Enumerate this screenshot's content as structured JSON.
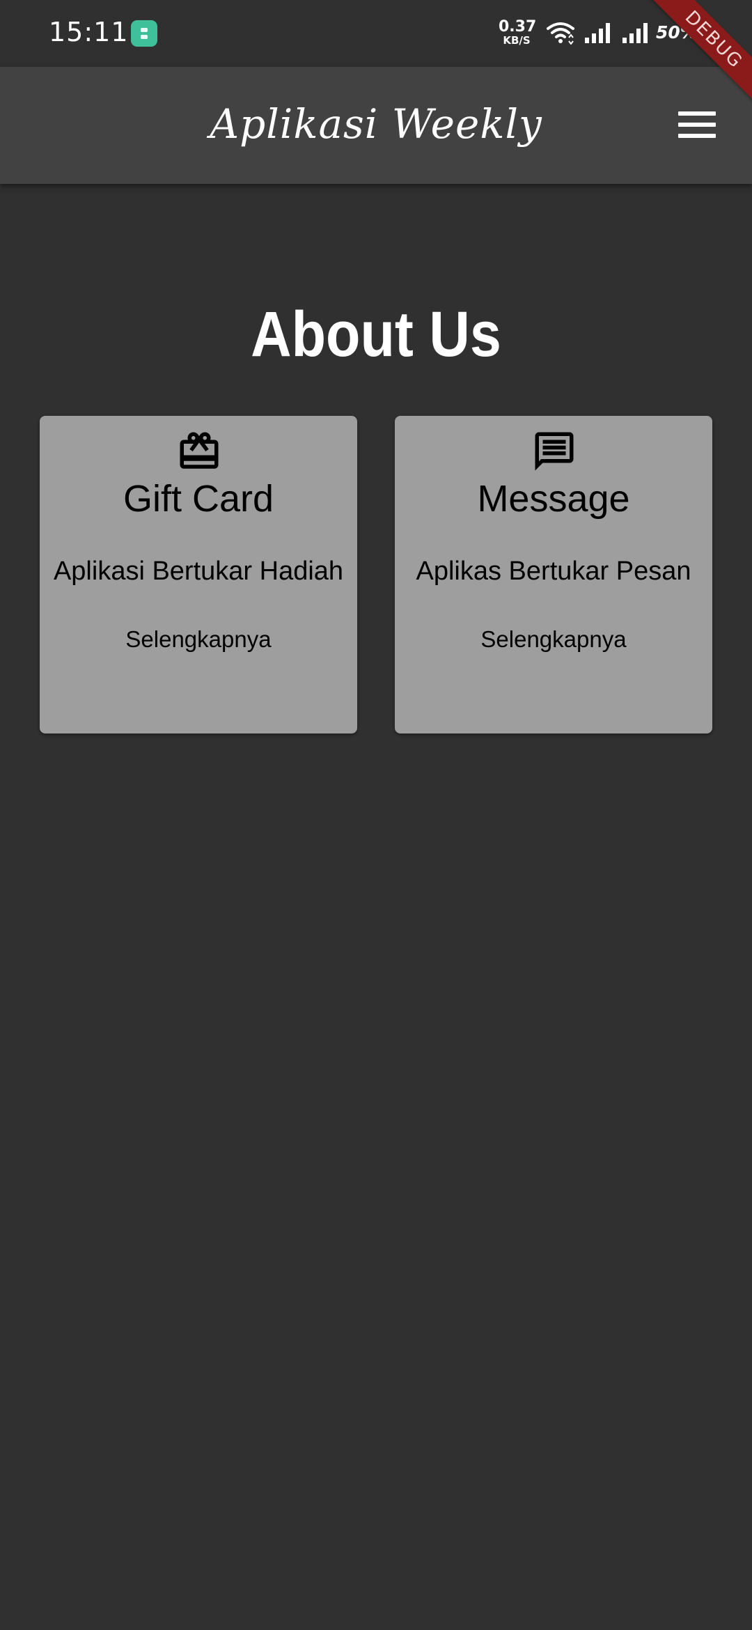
{
  "status_bar": {
    "time": "15:11",
    "net_speed_value": "0.37",
    "net_speed_unit": "KB/S",
    "battery": "50%"
  },
  "debug_banner": "DEBUG",
  "app_bar": {
    "title": "Aplikasi Weekly",
    "menu_icon": "hamburger-menu-icon"
  },
  "page": {
    "title": "About Us"
  },
  "cards": [
    {
      "icon": "card-giftcard-icon",
      "title": "Gift Card",
      "description": "Aplikasi Bertukar Hadiah",
      "link": "Selengkapnya"
    },
    {
      "icon": "message-icon",
      "title": "Message",
      "description": "Aplikas Bertukar Pesan",
      "link": "Selengkapnya"
    }
  ],
  "colors": {
    "background": "#303030",
    "app_bar": "#424242",
    "card": "#9e9e9e",
    "debug_banner": "#8b1b1b"
  }
}
